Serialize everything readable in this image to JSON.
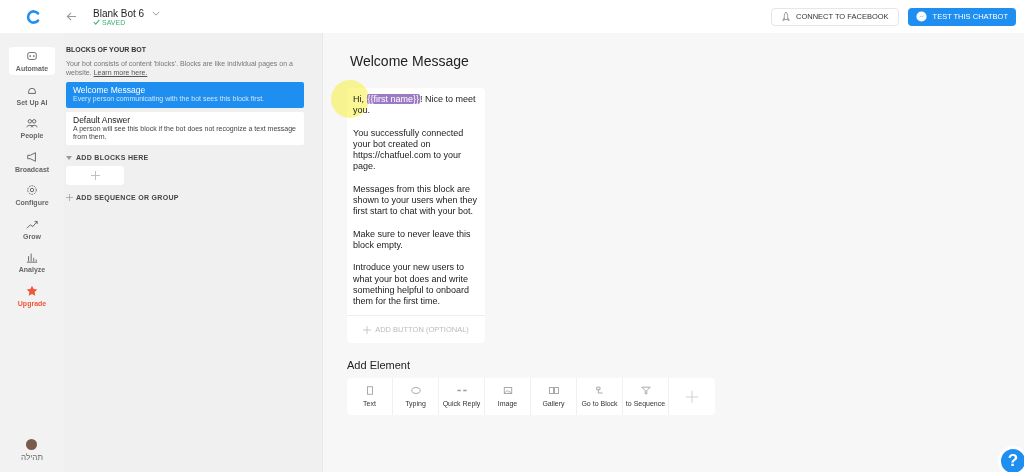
{
  "header": {
    "bot_name": "Blank Bot 6",
    "status": "SAVED",
    "connect_button": "CONNECT TO FACEBOOK",
    "test_button": "TEST THIS CHATBOT"
  },
  "nav": [
    {
      "label": "Automate",
      "selected": true,
      "kind": "normal"
    },
    {
      "label": "Set Up AI",
      "selected": false,
      "kind": "normal"
    },
    {
      "label": "People",
      "selected": false,
      "kind": "normal"
    },
    {
      "label": "Broadcast",
      "selected": false,
      "kind": "normal"
    },
    {
      "label": "Configure",
      "selected": false,
      "kind": "normal"
    },
    {
      "label": "Grow",
      "selected": false,
      "kind": "normal"
    },
    {
      "label": "Analyze",
      "selected": false,
      "kind": "normal"
    },
    {
      "label": "Upgrade",
      "selected": false,
      "kind": "upgrade"
    }
  ],
  "user": {
    "name": "תהילה"
  },
  "blocks_panel": {
    "title": "BLOCKS OF YOUR BOT",
    "intro": "Your bot consists of content 'blocks'. Blocks are like individual pages on a website.",
    "learn_more": "Learn more here.",
    "blocks": [
      {
        "title": "Welcome Message",
        "description": "Every person communicating with the bot sees this block first.",
        "selected": true
      },
      {
        "title": "Default Answer",
        "description": "A person will see this block if the bot does not recognize a text message from them.",
        "selected": false
      }
    ],
    "group_label": "ADD BLOCKS HERE",
    "add_group": "ADD SEQUENCE OR GROUP"
  },
  "editor": {
    "title": "Welcome Message",
    "message": {
      "greeting_before": "Hi, ",
      "variable": "{{first name}}",
      "greeting_after": "! Nice to meet you.",
      "paragraphs": [
        "You successfully connected your bot created on https://chatfuel.com to your page.",
        "Messages from this block are shown to your users when they first start to chat with your bot.",
        "Make sure to never leave this block empty.",
        "Introduce your new users to what your bot does and write something helpful to onboard them for the first time."
      ],
      "add_button": "ADD BUTTON (OPTIONAL)"
    },
    "add_element_title": "Add Element",
    "elements": [
      {
        "kind": "element",
        "label": "Text"
      },
      {
        "kind": "element",
        "label": "Typing"
      },
      {
        "kind": "element",
        "label": "Quick Reply"
      },
      {
        "kind": "element",
        "label": "Image"
      },
      {
        "kind": "element",
        "label": "Gallery"
      },
      {
        "kind": "element",
        "label": "Go to Block"
      },
      {
        "kind": "element",
        "label": "to Sequence"
      },
      {
        "kind": "add"
      }
    ]
  },
  "help_button": "?"
}
